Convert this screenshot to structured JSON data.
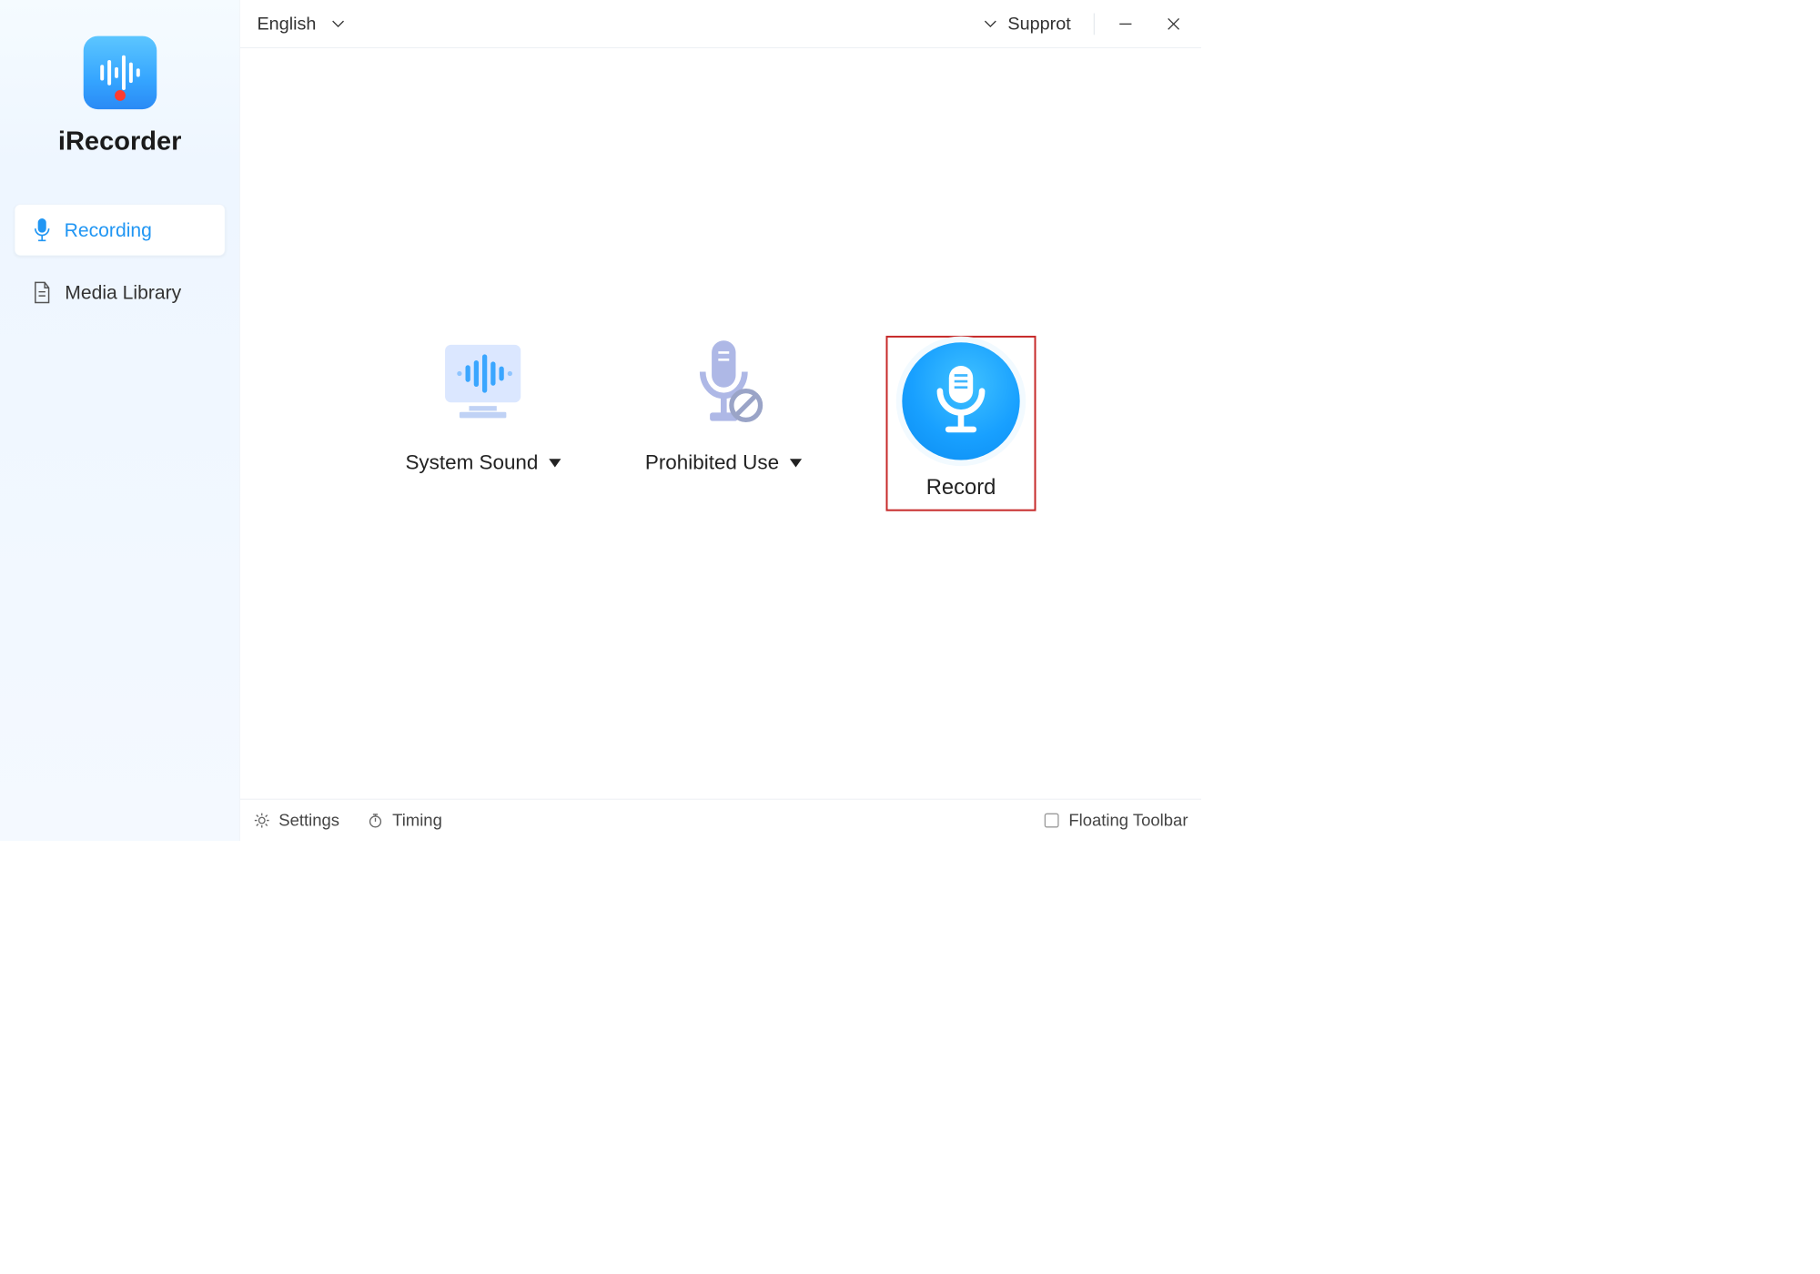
{
  "app": {
    "name": "iRecorder"
  },
  "sidebar": {
    "items": [
      {
        "label": "Recording",
        "active": true
      },
      {
        "label": "Media Library",
        "active": false
      }
    ]
  },
  "topbar": {
    "language": "English",
    "support_label": "Supprot"
  },
  "recording": {
    "system_sound_label": "System Sound",
    "mic_mode_label": "Prohibited Use",
    "record_button_label": "Record"
  },
  "statusbar": {
    "settings_label": "Settings",
    "timing_label": "Timing",
    "floating_toolbar_label": "Floating Toolbar",
    "floating_toolbar_checked": false
  }
}
